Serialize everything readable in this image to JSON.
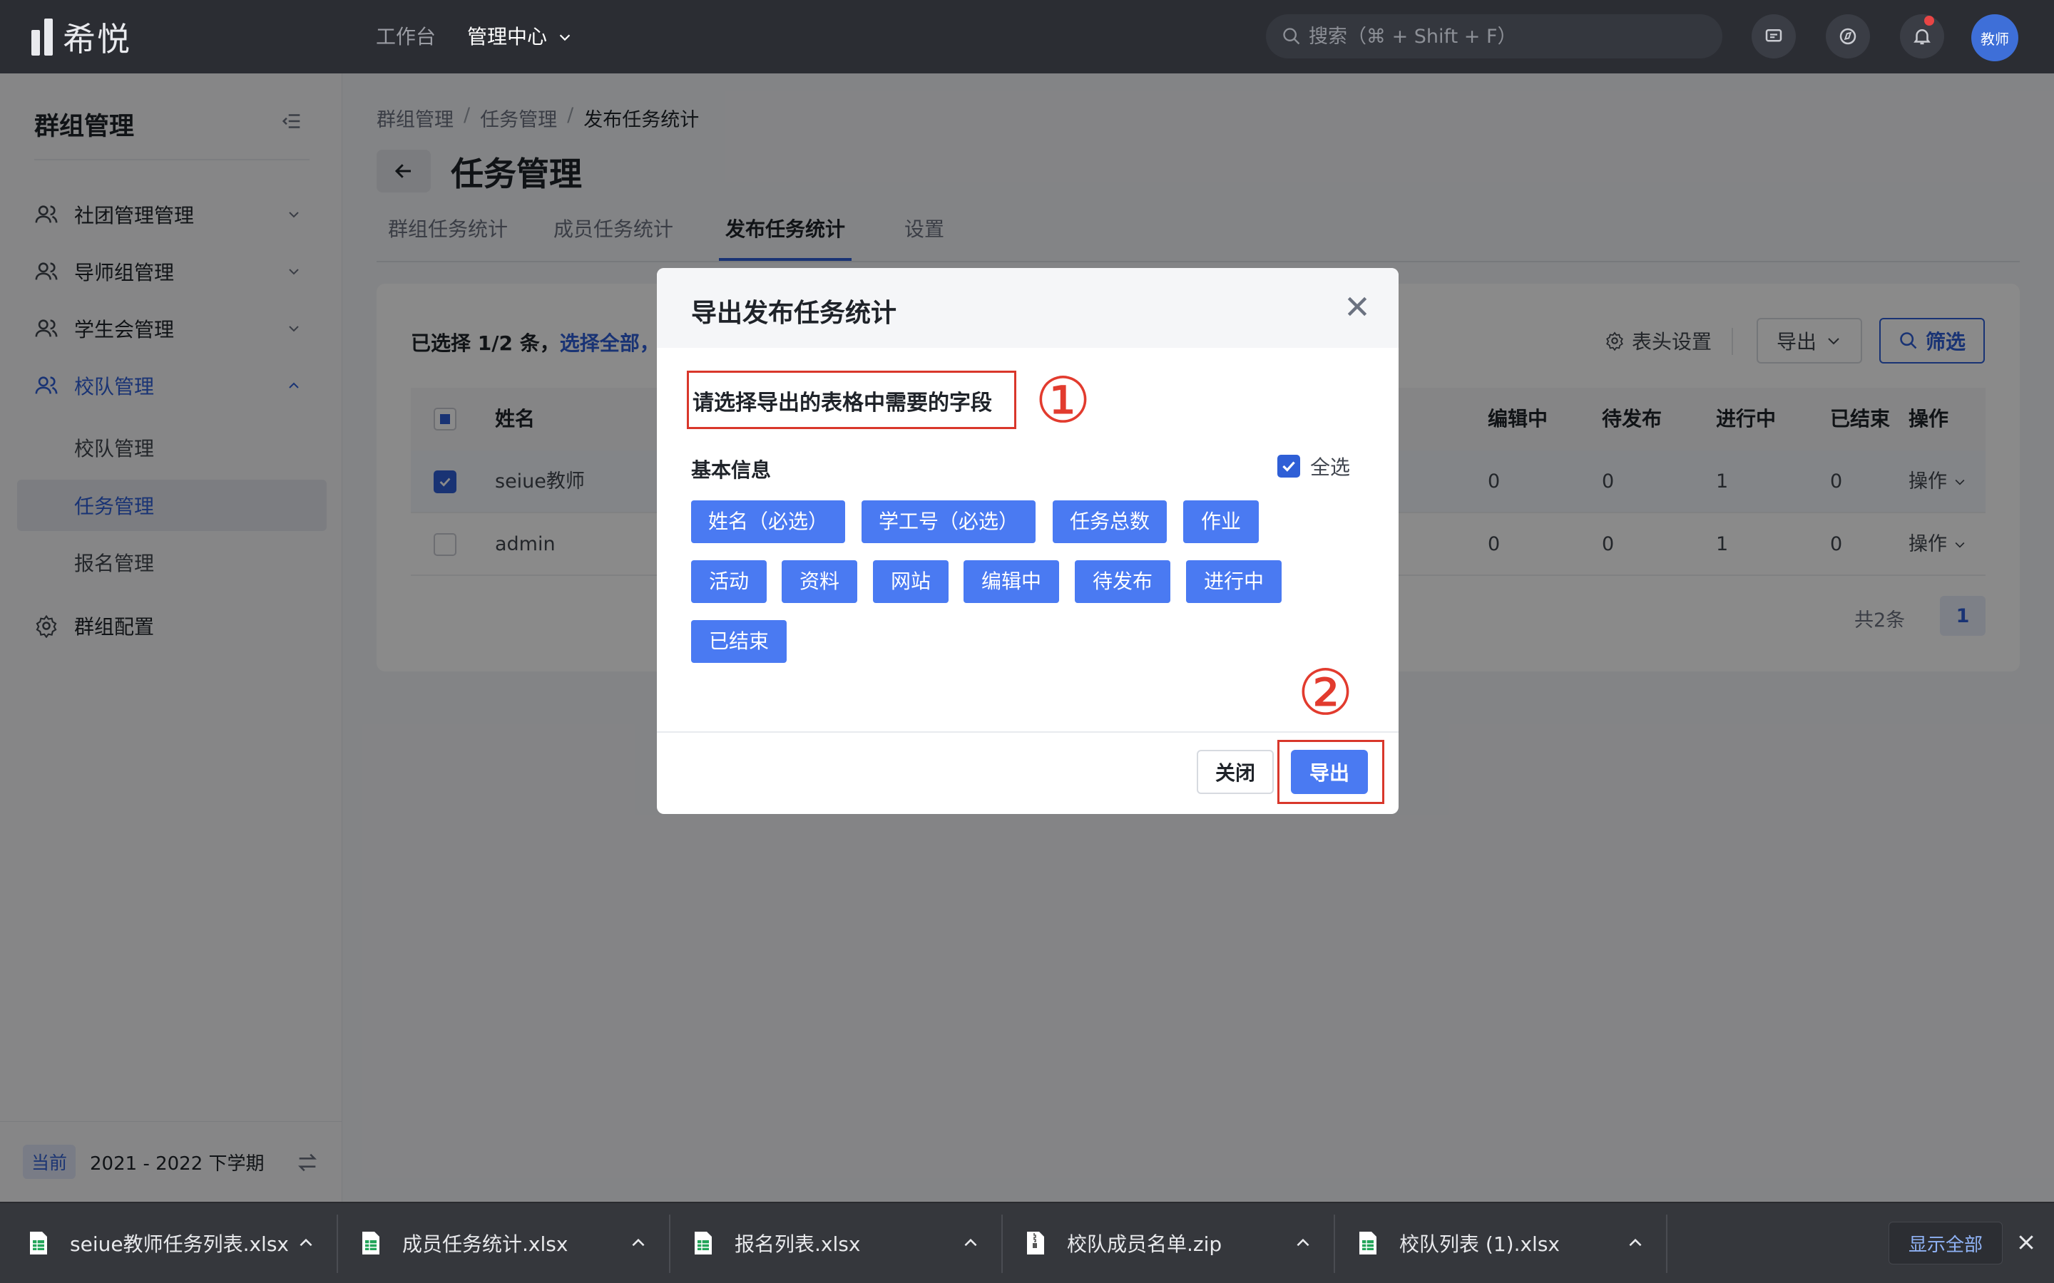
{
  "app": {
    "logo_text": "希悦",
    "nav": [
      {
        "label": "工作台"
      },
      {
        "label": "管理中心"
      }
    ],
    "search_placeholder": "搜索（⌘ + Shift + F）",
    "avatar": "教师"
  },
  "sidebar": {
    "title": "群组管理",
    "menus": [
      {
        "label": "社团管理管理"
      },
      {
        "label": "导师组管理"
      },
      {
        "label": "学生会管理"
      },
      {
        "label": "校队管理"
      }
    ],
    "subitems": [
      {
        "label": "校队管理"
      },
      {
        "label": "任务管理"
      },
      {
        "label": "报名管理"
      }
    ],
    "config": "群组配置",
    "term_badge": "当前",
    "term": "2021 - 2022 下学期"
  },
  "main": {
    "breadcrumb": [
      "群组管理",
      "任务管理",
      "发布任务统计"
    ],
    "breadcrumb_sep": "/",
    "title": "任务管理",
    "tabs": [
      "群组任务统计",
      "成员任务统计",
      "发布任务统计",
      "设置"
    ],
    "selection_prefix": "已选择 1/2 条，",
    "selection_link": "选择全部，",
    "header_settings": "表头设置",
    "export": "导出",
    "filter": "筛选",
    "table": {
      "columns": [
        "姓名",
        "编辑中",
        "待发布",
        "进行中",
        "已结束",
        "操作"
      ],
      "rows": [
        {
          "name": "seiue教师",
          "editing": "0",
          "pending": "0",
          "ongoing": "1",
          "ended": "0",
          "action": "操作"
        },
        {
          "name": "admin",
          "editing": "0",
          "pending": "0",
          "ongoing": "1",
          "ended": "0",
          "action": "操作"
        }
      ]
    },
    "total": "共2条",
    "page": "1"
  },
  "modal": {
    "title": "导出发布任务统计",
    "prompt": "请选择导出的表格中需要的字段",
    "step1": "①",
    "step2": "②",
    "section": "基本信息",
    "select_all": "全选",
    "tags": [
      "姓名（必选）",
      "学工号（必选）",
      "任务总数",
      "作业",
      "活动",
      "资料",
      "网站",
      "编辑中",
      "待发布",
      "进行中",
      "已结束"
    ],
    "close": "关闭",
    "export": "导出"
  },
  "downloads": {
    "items": [
      {
        "name": "seiue教师任务列表.xlsx",
        "type": "xlsx"
      },
      {
        "name": "成员任务统计.xlsx",
        "type": "xlsx"
      },
      {
        "name": "报名列表.xlsx",
        "type": "xlsx"
      },
      {
        "name": "校队成员名单.zip",
        "type": "zip"
      },
      {
        "name": "校队列表 (1).xlsx",
        "type": "xlsx"
      }
    ],
    "show_all": "显示全部"
  },
  "colors": {
    "accent": "#2f5fd6",
    "tag": "#4a7af2",
    "highlight": "#d9372b",
    "topbar": "#2b2d33"
  }
}
